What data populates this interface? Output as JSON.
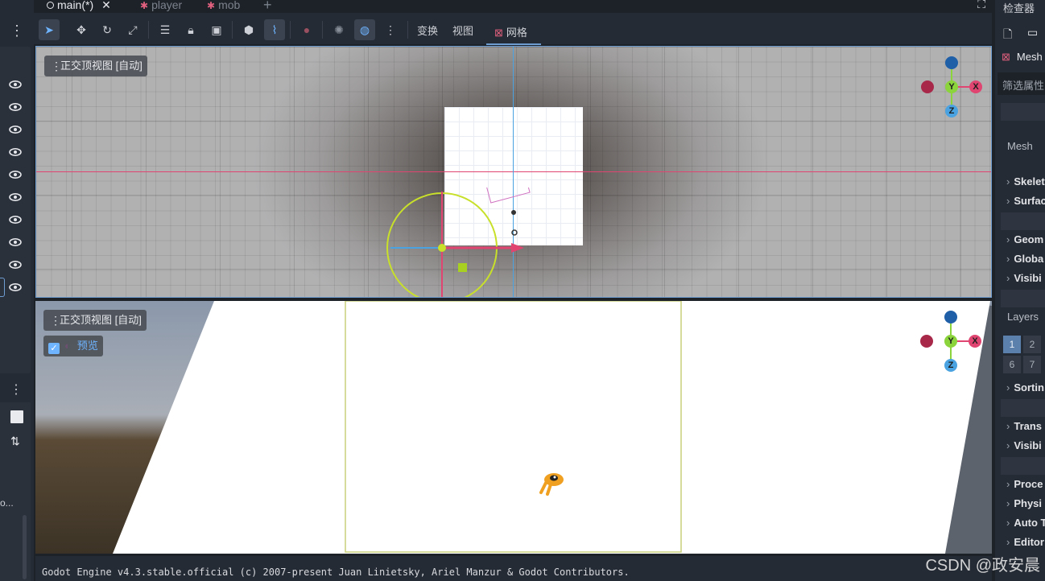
{
  "tabs": [
    {
      "label": "main(*)",
      "close": "✕"
    },
    {
      "label": "player"
    },
    {
      "label": "mob"
    }
  ],
  "add_tab_label": "+",
  "toolbar": {
    "transform_menu": "变换",
    "view_menu": "视图",
    "grid_menu": "网格"
  },
  "viewport_top": {
    "label": "正交顶视图 [自动]"
  },
  "viewport_bottom": {
    "label": "正交顶视图 [自动]",
    "preview_label": "预览",
    "preview_checked": true
  },
  "gizmo_axes": {
    "y": "Y",
    "x": "X",
    "z": "Z"
  },
  "console": {
    "line1": "Godot Engine v4.3.stable.official (c) 2007-present Juan Linietsky, Ariel Manzur & Godot Contributors."
  },
  "inspector": {
    "title": "检查器",
    "node_type": "Mesh",
    "filter_placeholder": "筛选属性",
    "mesh_label": "Mesh",
    "sections": [
      "Skelet",
      "Surfac",
      "Geom",
      "Globa",
      "Visibi",
      "Sortin",
      "Trans",
      "Visibi",
      "Proce",
      "Physi",
      "Auto T",
      "Editor"
    ],
    "layers_label": "Layers",
    "layers_row1": [
      "1",
      "2"
    ],
    "layers_row2": [
      "6",
      "7"
    ]
  },
  "left_dock": {
    "truncated_text": "o..."
  },
  "watermark": "CSDN @政安晨",
  "colors": {
    "accent": "#6e9dd1",
    "x_axis": "#e04470",
    "y_axis": "#8cd43c",
    "z_axis": "#4aa3e0",
    "selection": "#c8e02a"
  }
}
